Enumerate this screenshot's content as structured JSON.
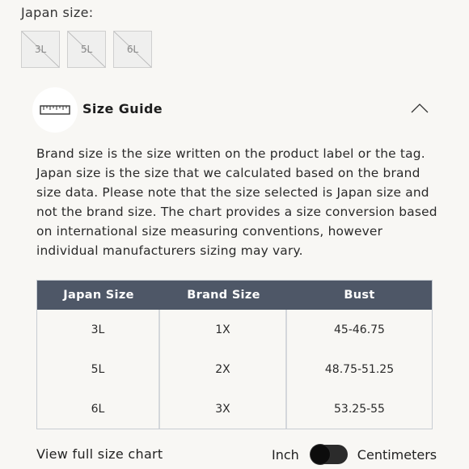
{
  "japan_size": {
    "label": "Japan size:",
    "options": [
      "3L",
      "5L",
      "6L"
    ]
  },
  "size_guide": {
    "title": "Size Guide",
    "description_lines": [
      "Brand size is the size written on the product label or the tag.",
      "Japan size is the size that we calculated based on the brand",
      "size data. Please note that the size selected is Japan size and",
      "not the brand size. The chart provides a size conversion based",
      "on international size measuring conventions, however",
      "individual manufacturers sizing may vary."
    ]
  },
  "table": {
    "headers": [
      "Japan Size",
      "Brand Size",
      "Bust"
    ],
    "rows": [
      [
        "3L",
        "1X",
        "45-46.75"
      ],
      [
        "5L",
        "2X",
        "48.75-51.25"
      ],
      [
        "6L",
        "3X",
        "53.25-55"
      ]
    ]
  },
  "footer": {
    "full_chart_link": "View full size chart",
    "unit_left": "Inch",
    "unit_right": "Centimeters"
  },
  "colors": {
    "table_header_bg": "#4e5767",
    "page_bg": "#f8f7f4"
  },
  "icons": {
    "ruler": "ruler-icon",
    "chevron": "chevron-up-icon"
  }
}
